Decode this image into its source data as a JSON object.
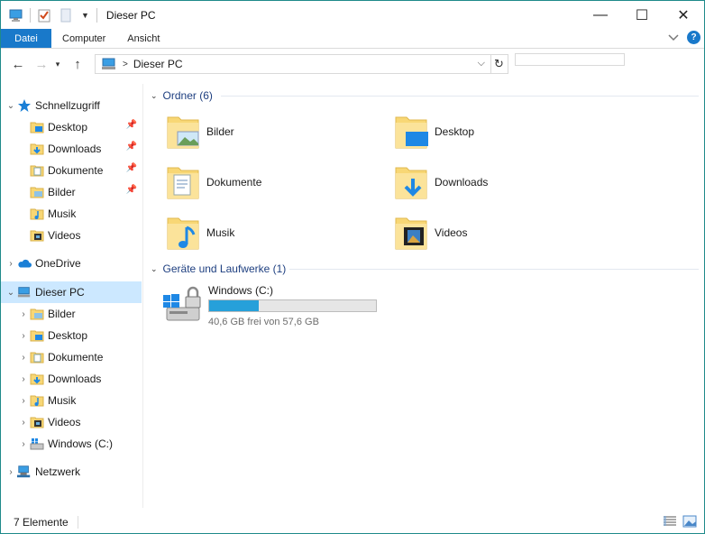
{
  "window": {
    "title": "Dieser PC",
    "controls": {
      "minimize": "—",
      "maximize": "☐",
      "close": "✕"
    }
  },
  "ribbon": {
    "tabs": [
      "Datei",
      "Computer",
      "Ansicht"
    ],
    "help": "?"
  },
  "address": {
    "crumbs": [
      "Dieser PC"
    ],
    "search_placeholder": ""
  },
  "navpane": {
    "quick_access": {
      "label": "Schnellzugriff",
      "items": [
        {
          "label": "Desktop",
          "icon": "desktop-folder-icon",
          "pinned": true
        },
        {
          "label": "Downloads",
          "icon": "downloads-folder-icon",
          "pinned": true
        },
        {
          "label": "Dokumente",
          "icon": "documents-folder-icon",
          "pinned": true
        },
        {
          "label": "Bilder",
          "icon": "pictures-folder-icon",
          "pinned": true
        },
        {
          "label": "Musik",
          "icon": "music-folder-icon",
          "pinned": false
        },
        {
          "label": "Videos",
          "icon": "videos-folder-icon",
          "pinned": false
        }
      ]
    },
    "onedrive": {
      "label": "OneDrive"
    },
    "this_pc": {
      "label": "Dieser PC",
      "items": [
        {
          "label": "Bilder"
        },
        {
          "label": "Desktop"
        },
        {
          "label": "Dokumente"
        },
        {
          "label": "Downloads"
        },
        {
          "label": "Musik"
        },
        {
          "label": "Videos"
        },
        {
          "label": "Windows (C:)"
        }
      ]
    },
    "network": {
      "label": "Netzwerk"
    }
  },
  "content": {
    "folders_header": "Ordner (6)",
    "folders": [
      {
        "label": "Bilder",
        "icon": "pictures-folder-icon"
      },
      {
        "label": "Desktop",
        "icon": "desktop-folder-icon"
      },
      {
        "label": "Dokumente",
        "icon": "documents-folder-icon"
      },
      {
        "label": "Downloads",
        "icon": "downloads-folder-icon"
      },
      {
        "label": "Musik",
        "icon": "music-folder-icon"
      },
      {
        "label": "Videos",
        "icon": "videos-folder-icon"
      }
    ],
    "drives_header": "Geräte und Laufwerke (1)",
    "drive": {
      "name": "Windows (C:)",
      "free_text": "40,6 GB frei von 57,6 GB",
      "used_fraction": 0.295
    }
  },
  "status": {
    "count": "7 Elemente"
  },
  "colors": {
    "accent": "#1979ca",
    "selection": "#cce8ff",
    "group_header": "#1e3f80",
    "drive_fill": "#26a0da",
    "folder_yellow": "#f8d775"
  }
}
